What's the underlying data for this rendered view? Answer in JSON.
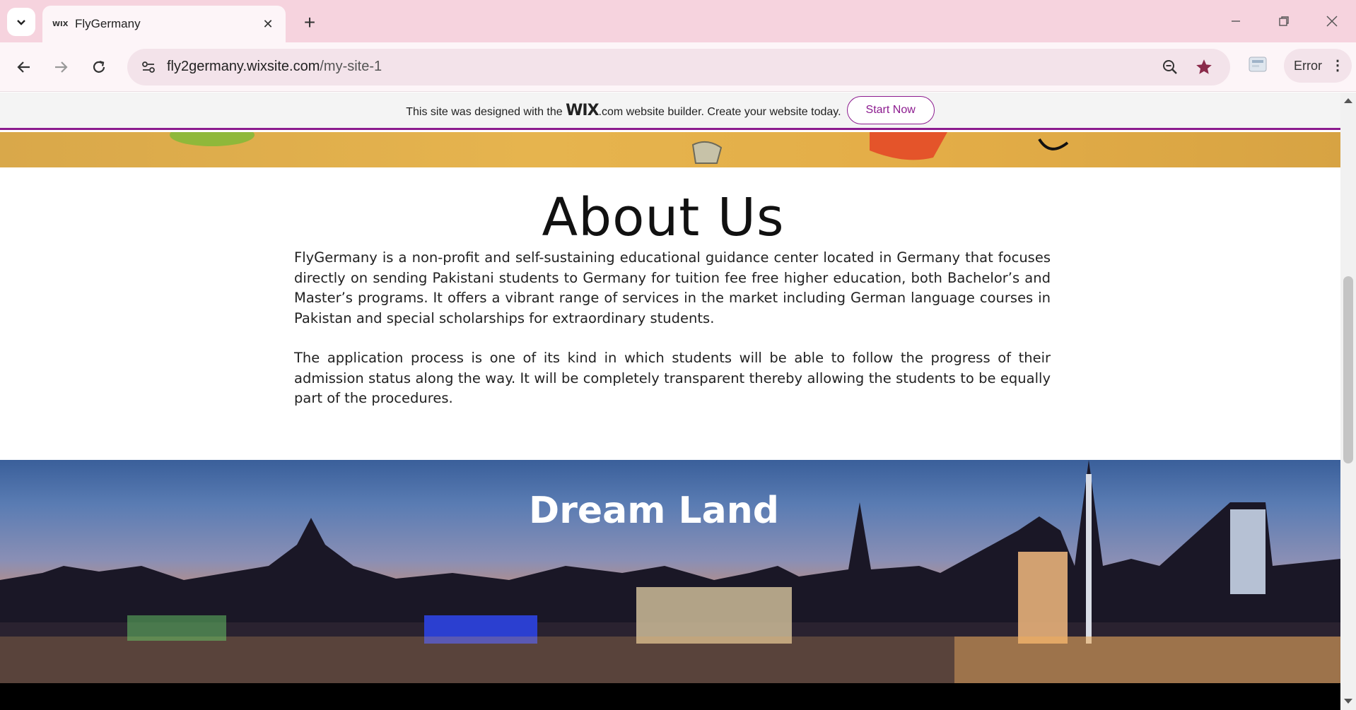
{
  "browser": {
    "tab": {
      "favicon_text": "WIX",
      "title": "FlyGermany"
    },
    "url": {
      "domain": "fly2germany.wixsite.com",
      "path": "/my-site-1"
    },
    "profile_button_label": "Error"
  },
  "wix_banner": {
    "text_before": "This site was designed with the",
    "brand": "WIX",
    "text_after": ".com website builder. Create your website today.",
    "button_label": "Start Now"
  },
  "about": {
    "heading": "About Us",
    "paragraph1": "FlyGermany is a non-profit and self-sustaining educational guidance center located in Germany that focuses directly on sending Pakistani students to Germany for tuition fee free higher education, both Bachelor’s and Master’s programs. It offers a vibrant range of services in the market including German language courses in Pakistan and special scholarships for extraordinary students.",
    "paragraph2": "The application process is one of its kind in which students will be able to follow the progress of their admission status along the way. It will be completely transparent thereby allowing the students to be equally part of the procedures."
  },
  "dream_section": {
    "heading": "Dream Land"
  },
  "colors": {
    "accent": "#8c1b8f",
    "tab_bar": "#f6d3de",
    "toolbar": "#fdf5f8"
  }
}
